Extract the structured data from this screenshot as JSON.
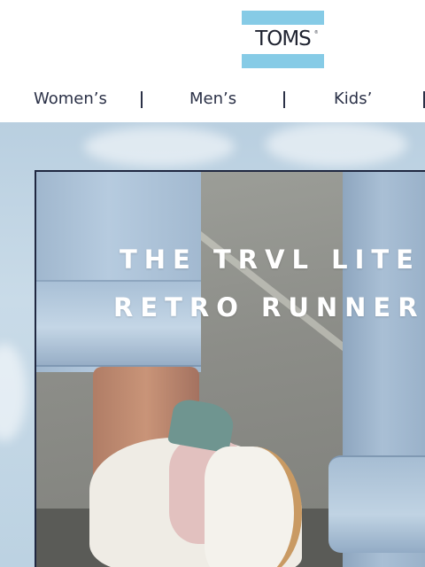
{
  "brand": {
    "logo_text": "TOMS",
    "registered_mark": "®",
    "colors": {
      "logo_stripe": "#86cbe6",
      "text": "#1f2330"
    }
  },
  "nav": {
    "items": [
      {
        "label": "Women’s"
      },
      {
        "label": "Men’s"
      },
      {
        "label": "Kids’"
      }
    ],
    "separator": "|"
  },
  "hero": {
    "headline_line1": "THE TRVL LITE",
    "headline_line2": "RETRO RUNNER",
    "image_subject": "pink and white retro runner sneaker with teal heel tab, worn with cuffed light-wash jeans"
  }
}
